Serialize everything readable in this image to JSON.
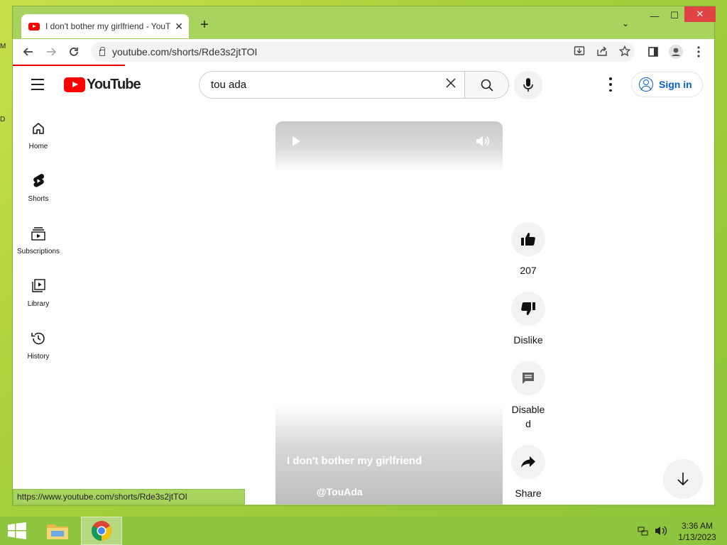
{
  "desktop": {
    "edge_chars": [
      "M",
      "D"
    ]
  },
  "browser": {
    "tab_title": "I don't bother my girlfriend - YouTube",
    "tab_close": "✕",
    "new_tab": "+",
    "tab_search": "⌄",
    "window_controls": {
      "minimize": "—",
      "maximize": "☐",
      "close": "✕"
    },
    "url": "youtube.com/shorts/Rde3s2jtTOI",
    "status_url": "https://www.youtube.com/shorts/Rde3s2jtTOI"
  },
  "youtube": {
    "logo_text": "YouTube",
    "search_query": "tou ada",
    "signin_label": "Sign in",
    "sidebar": [
      {
        "label": "Home",
        "icon": "home-icon"
      },
      {
        "label": "Shorts",
        "icon": "shorts-icon"
      },
      {
        "label": "Subscriptions",
        "icon": "subscriptions-icon"
      },
      {
        "label": "Library",
        "icon": "library-icon"
      },
      {
        "label": "History",
        "icon": "history-icon"
      }
    ],
    "short": {
      "title": "I don't bother my girlfriend",
      "channel": "@TouAda"
    },
    "actions": {
      "like_count": "207",
      "dislike_label": "Dislike",
      "comments_label": "Disabled",
      "share_label": "Share"
    }
  },
  "taskbar": {
    "time": "3:36 AM",
    "date": "1/13/2023"
  }
}
